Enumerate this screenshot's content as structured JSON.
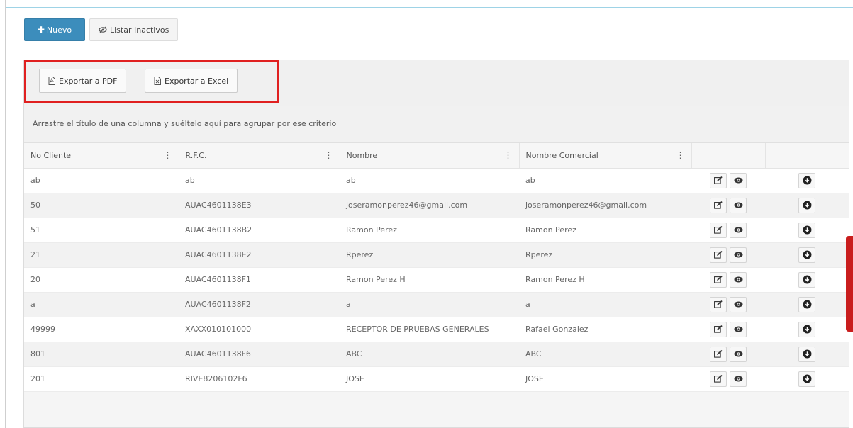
{
  "toolbar": {
    "new_label": "Nuevo",
    "list_inactive_label": "Listar Inactivos"
  },
  "export": {
    "pdf_label": "Exportar a PDF",
    "excel_label": "Exportar a Excel"
  },
  "grid": {
    "group_hint": "Arrastre el título de una columna y suéltelo aquí para agrupar por ese criterio",
    "columns": [
      "No Cliente",
      "R.F.C.",
      "Nombre",
      "Nombre Comercial"
    ],
    "rows": [
      {
        "no_cliente": "ab",
        "rfc": "ab",
        "nombre": "ab",
        "nombre_comercial": "ab"
      },
      {
        "no_cliente": "50",
        "rfc": "AUAC4601138E3",
        "nombre": "joseramonperez46@gmail.com",
        "nombre_comercial": "joseramonperez46@gmail.com"
      },
      {
        "no_cliente": "51",
        "rfc": "AUAC4601138B2",
        "nombre": "Ramon Perez",
        "nombre_comercial": "Ramon Perez"
      },
      {
        "no_cliente": "21",
        "rfc": "AUAC4601138E2",
        "nombre": "Rperez",
        "nombre_comercial": "Rperez"
      },
      {
        "no_cliente": "20",
        "rfc": "AUAC4601138F1",
        "nombre": "Ramon Perez H",
        "nombre_comercial": "Ramon Perez H"
      },
      {
        "no_cliente": "a",
        "rfc": "AUAC4601138F2",
        "nombre": "a",
        "nombre_comercial": "a"
      },
      {
        "no_cliente": "49999",
        "rfc": "XAXX010101000",
        "nombre": "RECEPTOR DE PRUEBAS GENERALES",
        "nombre_comercial": "Rafael Gonzalez"
      },
      {
        "no_cliente": "801",
        "rfc": "AUAC4601138F6",
        "nombre": "ABC",
        "nombre_comercial": "ABC"
      },
      {
        "no_cliente": "201",
        "rfc": "RIVE8206102F6",
        "nombre": "JOSE",
        "nombre_comercial": "JOSE"
      }
    ]
  },
  "icons": {
    "new": "plus-icon",
    "inactive": "eye-slash-icon",
    "pdf": "pdf-file-icon",
    "excel": "excel-file-icon",
    "edit": "edit-icon",
    "view": "eye-icon",
    "toggle": "circle-arrow-down-icon"
  },
  "colors": {
    "primary": "#3c8dbc",
    "highlight": "#e02020",
    "side_tab": "#c91d1d"
  }
}
